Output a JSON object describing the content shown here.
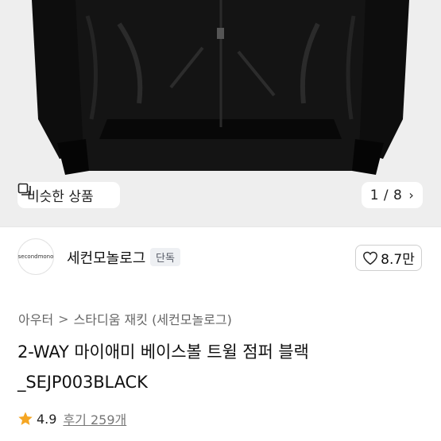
{
  "hero": {
    "background": "#eeeeee",
    "similar_label": "비슷한 상품",
    "similar_icon": "similar-products-icon",
    "counter": "1 / 8",
    "counter_icon": "chevron-right-icon"
  },
  "store": {
    "logo_text": "secondmono",
    "name": "세컨모놀로그",
    "badge": "단독",
    "likes": "8.7만",
    "like_icon": "heart-outline-icon"
  },
  "breadcrumb": {
    "items": [
      "아우터",
      "스타디움 재킷 (세컨모놀로그)"
    ],
    "separator": ">"
  },
  "product": {
    "title": "2-WAY 마이애미 베이스볼 트윌 점퍼 블랙_SEJP003BLACK"
  },
  "rating": {
    "score": "4.9",
    "reviews": "후기 259개",
    "star_color": "#f5a623"
  }
}
